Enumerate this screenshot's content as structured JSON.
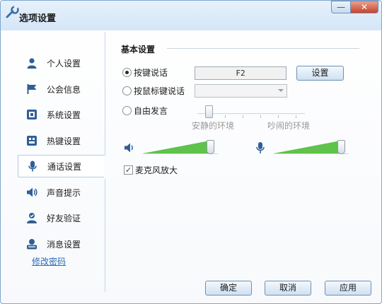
{
  "window": {
    "title": "选项设置",
    "title_icon": "wrench-icon",
    "minimize_label": "—",
    "close_label": "✕"
  },
  "sidebar": {
    "items": [
      {
        "label": "个人设置",
        "icon": "person-icon",
        "selected": false
      },
      {
        "label": "公会信息",
        "icon": "flag-icon",
        "selected": false
      },
      {
        "label": "系统设置",
        "icon": "system-icon",
        "selected": false
      },
      {
        "label": "热键设置",
        "icon": "keyboard-icon",
        "selected": false
      },
      {
        "label": "通话设置",
        "icon": "microphone-icon",
        "selected": true
      },
      {
        "label": "声音提示",
        "icon": "speaker-icon",
        "selected": false
      },
      {
        "label": "好友验证",
        "icon": "friend-check-icon",
        "selected": false
      },
      {
        "label": "消息设置",
        "icon": "message-icon",
        "selected": false
      }
    ],
    "change_password": "修改密码"
  },
  "main": {
    "section_title": "基本设置",
    "push_to_talk": {
      "label": "按键说话",
      "selected": true,
      "hotkey": "F2",
      "setting_button": "设置"
    },
    "mouse_to_talk": {
      "label": "按鼠标键说话",
      "selected": false,
      "value": ""
    },
    "free_talk": {
      "label": "自由发言",
      "selected": false,
      "caption_quiet": "安静的环境",
      "caption_noisy": "吵闹的环境",
      "level": 0.08
    },
    "speaker_volume": {
      "icon": "speaker-volume-icon",
      "level": 0.95
    },
    "mic_volume": {
      "icon": "microphone-volume-icon",
      "level": 0.95
    },
    "mic_boost": {
      "label": "麦克风放大",
      "checked": true
    }
  },
  "footer": {
    "ok": "确定",
    "cancel": "取消",
    "apply": "应用"
  },
  "colors": {
    "accent_green": "#5fc24a",
    "window_border": "#7fa6cf",
    "link_blue": "#2e6db8"
  }
}
